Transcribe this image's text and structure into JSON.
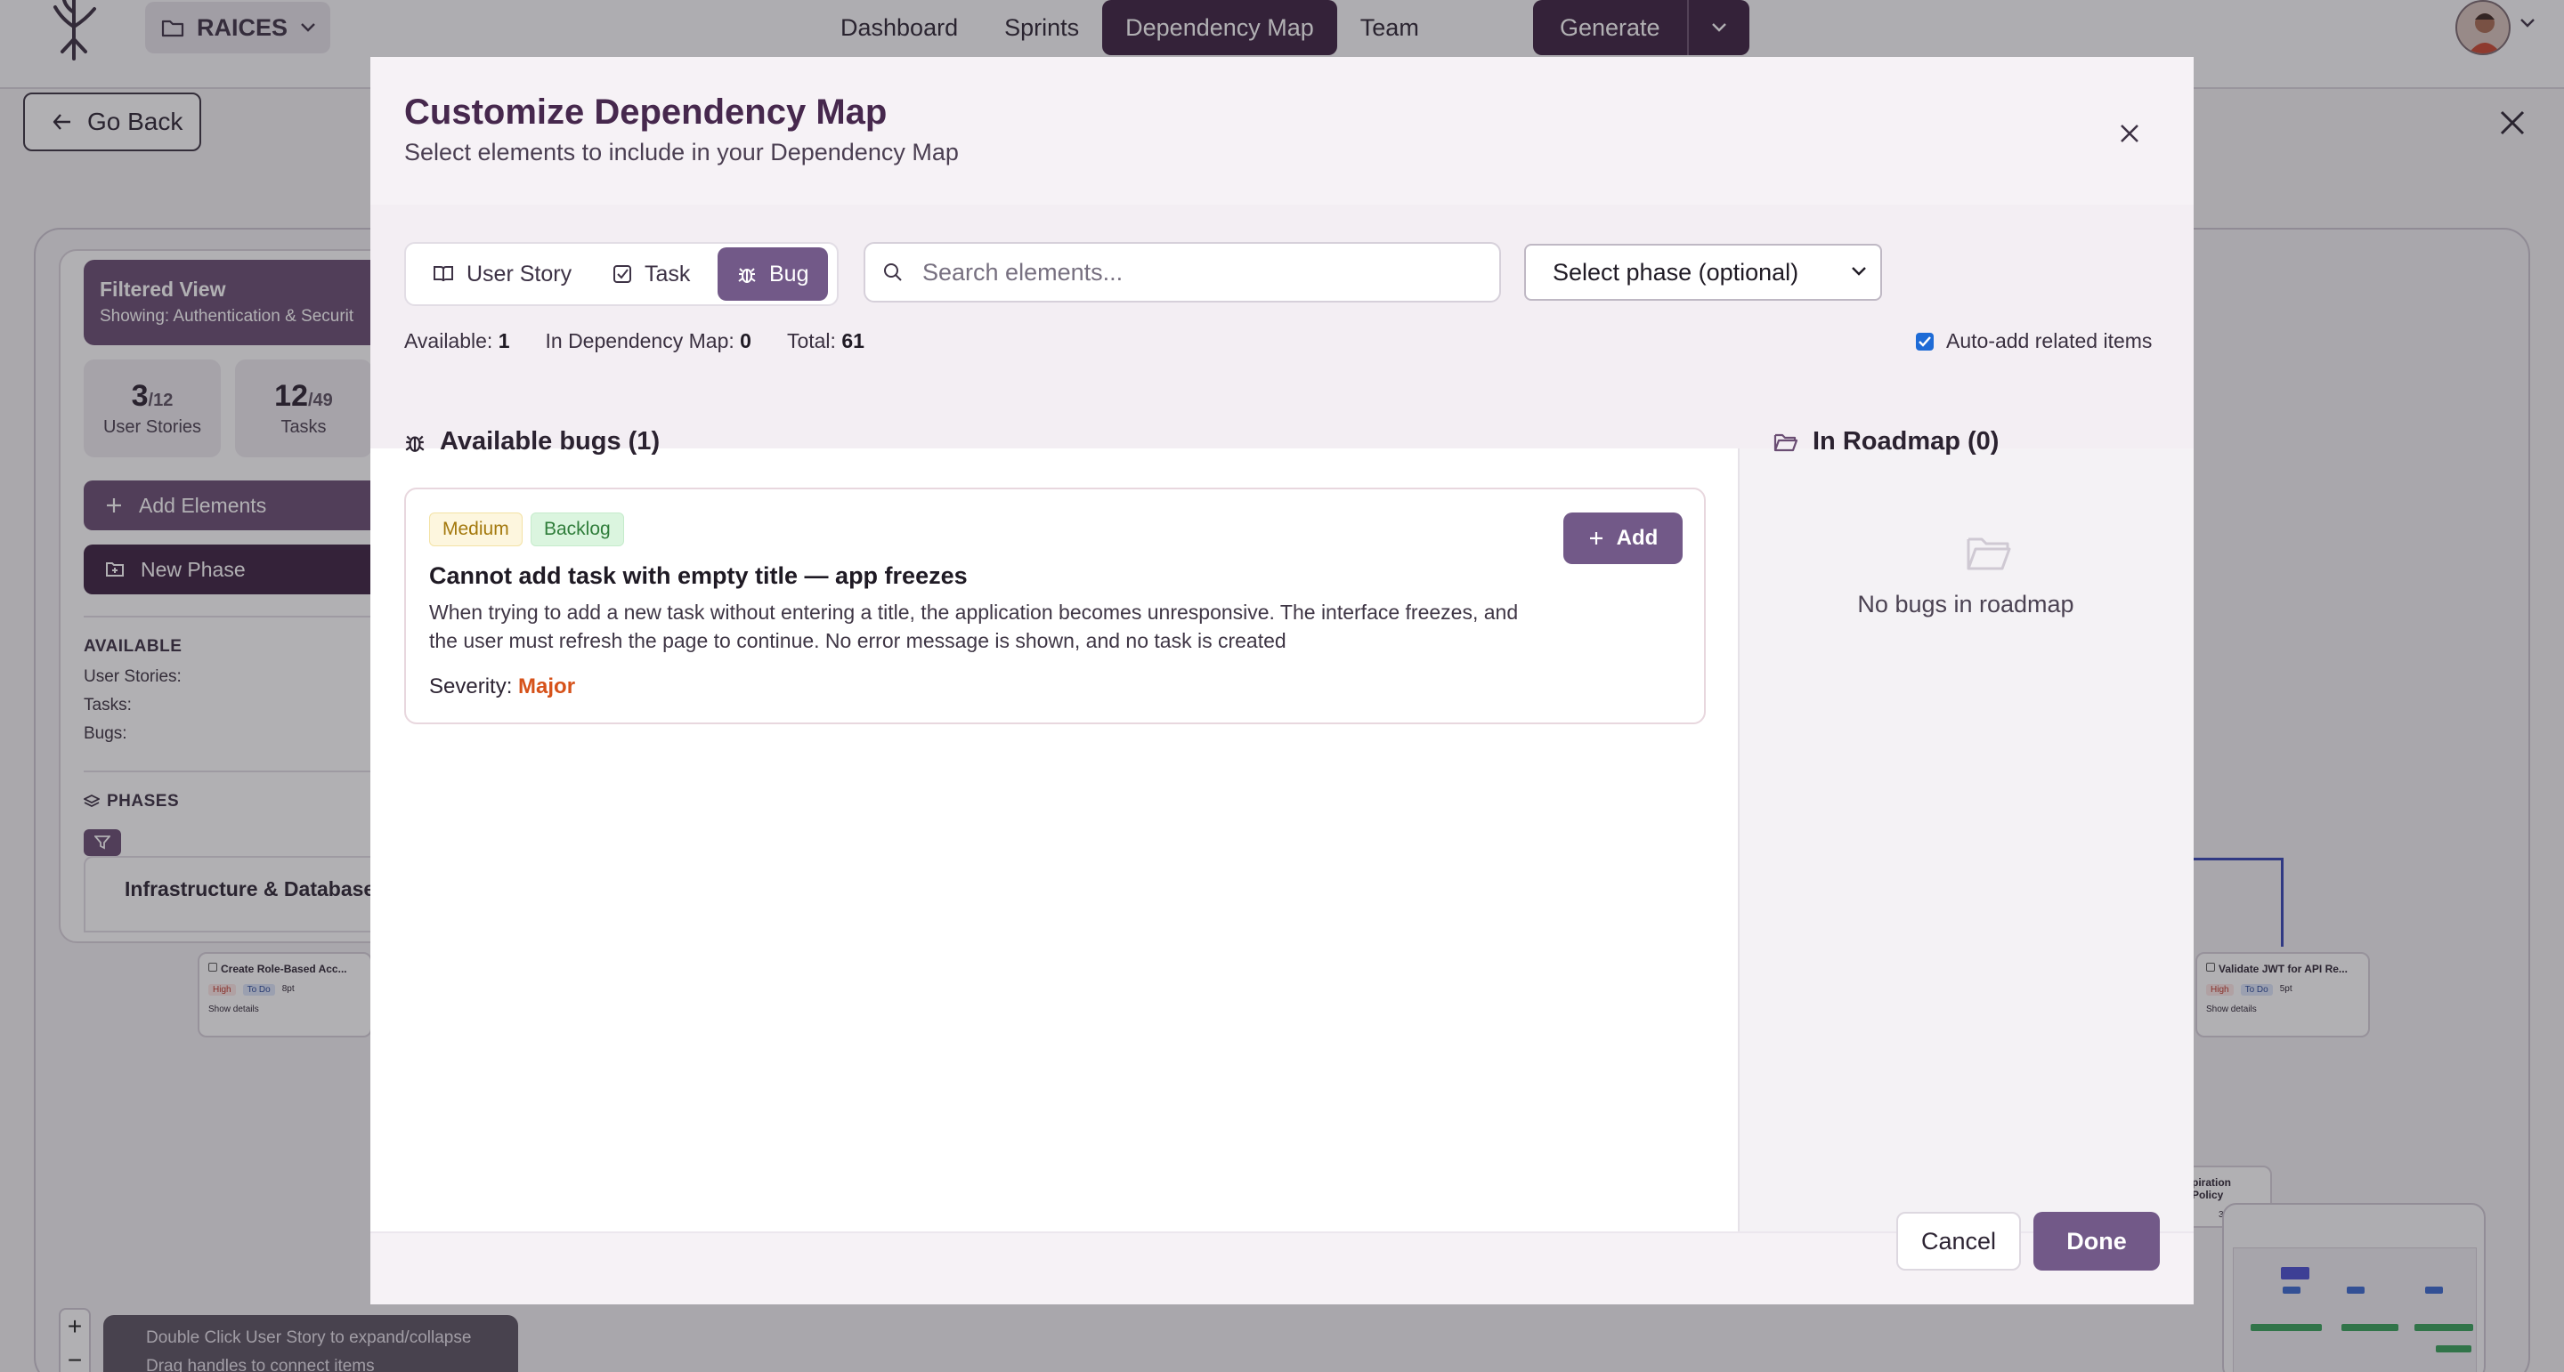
{
  "nav": {
    "project": "RAICES",
    "links": [
      "Dashboard",
      "Sprints",
      "Dependency Map",
      "Team"
    ],
    "active": "Dependency Map",
    "generate": "Generate"
  },
  "page": {
    "go_back": "Go Back",
    "filtered": {
      "title": "Filtered View",
      "subtitle": "Showing: Authentication & Securit"
    },
    "stats": [
      {
        "value": "3",
        "total": "/12",
        "label": "User Stories"
      },
      {
        "value": "12",
        "total": "/49",
        "label": "Tasks"
      }
    ],
    "add_elements": "Add Elements",
    "new_phase": "New Phase",
    "available_heading": "AVAILABLE",
    "available_rows": [
      "User Stories:",
      "Tasks:",
      "Bugs:"
    ],
    "phases_heading": "PHASES",
    "phase_item": "Infrastructure & Database",
    "cards": [
      {
        "title": "Create Role-Based Acc...",
        "priority": "High",
        "status": "To Do",
        "points": "8pt",
        "details": "Show details"
      },
      {
        "title": "Validate JWT for API Re...",
        "priority": "High",
        "status": "To Do",
        "points": "5pt",
        "details": "Show details"
      }
    ],
    "partial_card": {
      "title": "piration Policy",
      "points": "3pt"
    },
    "hints": [
      "Double Click User Story to expand/collapse",
      "Drag handles to connect items"
    ],
    "zoom": {
      "in": "+",
      "out": "−"
    }
  },
  "modal": {
    "title": "Customize Dependency Map",
    "subtitle": "Select elements to include in your Dependency Map",
    "tabs": [
      {
        "label": "User Story",
        "icon": "book-icon"
      },
      {
        "label": "Task",
        "icon": "checkbox-icon"
      },
      {
        "label": "Bug",
        "icon": "bug-icon"
      }
    ],
    "active_tab": "Bug",
    "search_placeholder": "Search elements...",
    "phase_select": "Select phase (optional)",
    "counts": {
      "available_label": "Available:",
      "available": "1",
      "in_map_label": "In Dependency Map:",
      "in_map": "0",
      "total_label": "Total:",
      "total": "61"
    },
    "auto_add_label": "Auto-add related items",
    "auto_add_checked": true,
    "available_title": "Available bugs (1)",
    "roadmap_title": "In Roadmap (0)",
    "roadmap_empty": "No bugs in roadmap",
    "bug": {
      "priority": "Medium",
      "status": "Backlog",
      "title": "Cannot add task with empty title — app freezes",
      "description": "When trying to add a new task without entering a title, the application becomes unresponsive. The interface freezes, and the user must refresh the page to continue. No error message is shown, and no task is created",
      "severity_label": "Severity:",
      "severity": "Major",
      "add_label": "Add"
    },
    "cancel": "Cancel",
    "done": "Done"
  },
  "colors": {
    "accent": "#725988",
    "nav_active": "#3c2140",
    "title": "#46284d",
    "severity": "#d6521a"
  }
}
